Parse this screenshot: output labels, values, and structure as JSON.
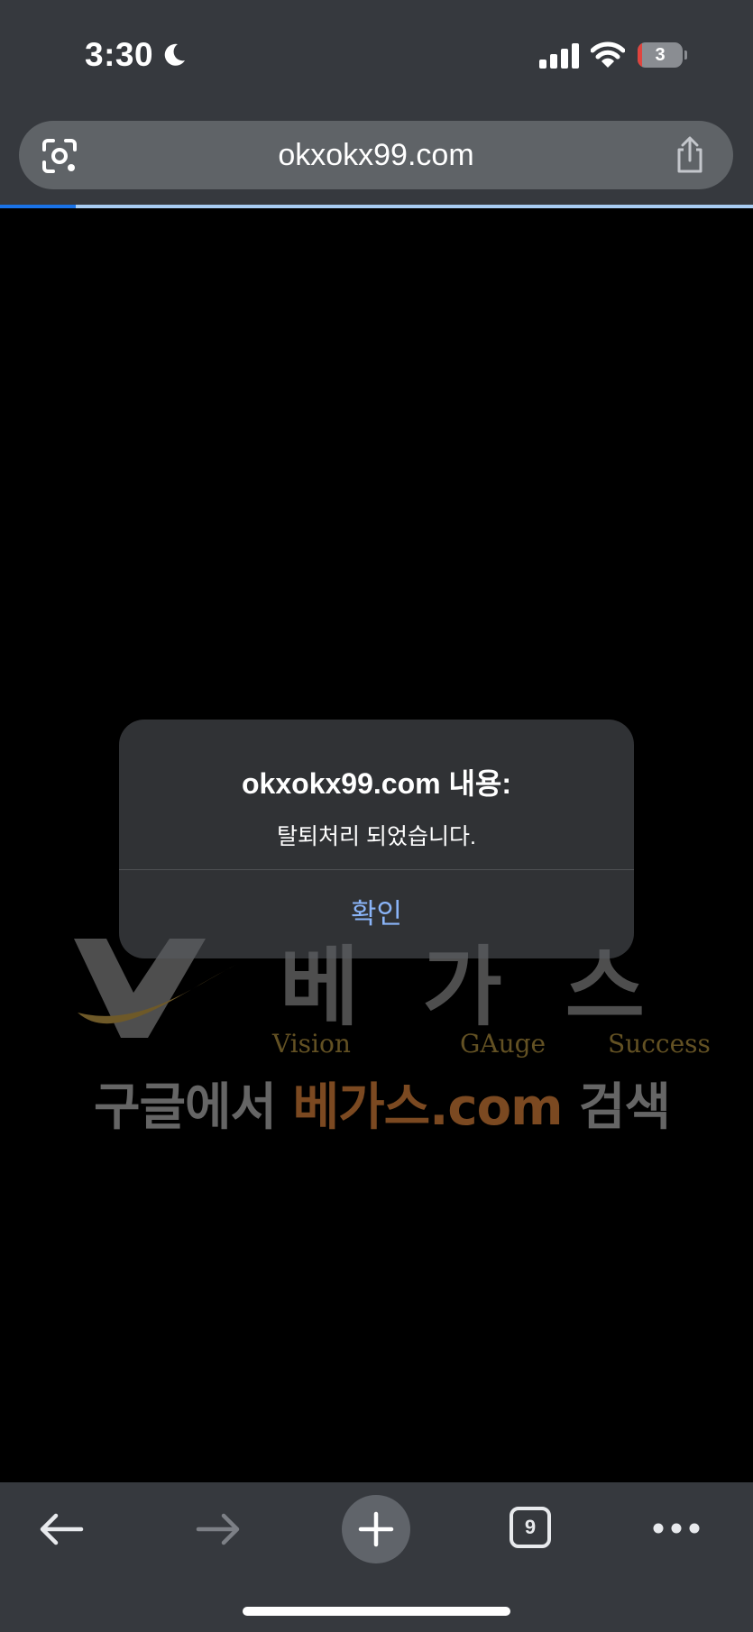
{
  "status_bar": {
    "time": "3:30",
    "battery_level": "3",
    "battery_fraction": 0.1,
    "icons": [
      "moon-icon",
      "cellular-signal-icon",
      "wifi-icon",
      "battery-icon"
    ]
  },
  "address_bar": {
    "url": "okxokx99.com",
    "left_icon": "google-lens-icon",
    "right_icon": "share-icon"
  },
  "page_load": {
    "progress_fraction": 0.1
  },
  "watermark": {
    "brand": "베가스",
    "slogan_words": [
      "Vision",
      "GAuge",
      "Success"
    ],
    "banner_prefix": "구글에서 ",
    "banner_accent": "베가스.com",
    "banner_suffix": " 검색"
  },
  "alert": {
    "title": "okxokx99.com 내용:",
    "message": "탈퇴처리 되었습니다.",
    "ok_label": "확인"
  },
  "toolbar": {
    "tab_count": "9",
    "icons": [
      "back-arrow-icon",
      "forward-arrow-icon",
      "plus-icon",
      "tab-switcher-icon",
      "more-horizontal-icon"
    ]
  },
  "colors": {
    "chrome_bg": "#36393e",
    "address_bar_bg": "#5f6367",
    "progress_blue": "#1a73e8",
    "link_blue": "#8ab4f8",
    "battery_red": "#e0443e",
    "watermark_accent": "#e0863c"
  }
}
